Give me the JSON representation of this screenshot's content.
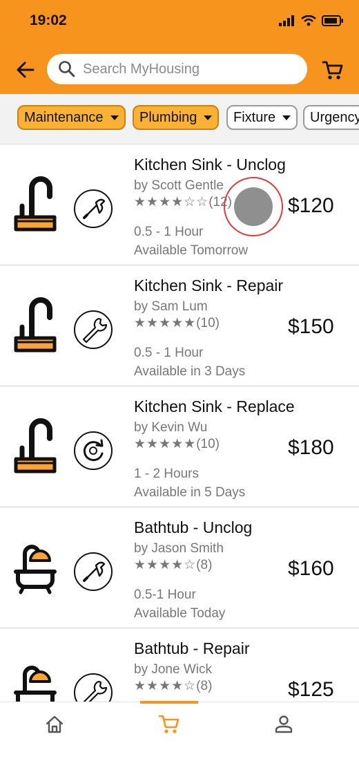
{
  "status_bar": {
    "time": "19:02"
  },
  "search": {
    "placeholder": "Search MyHousing"
  },
  "filters": [
    {
      "label": "Maintenance",
      "active": true
    },
    {
      "label": "Plumbing",
      "active": true
    },
    {
      "label": "Fixture",
      "active": false
    },
    {
      "label": "Urgency",
      "active": false
    }
  ],
  "items": [
    {
      "title": "Kitchen Sink - Unclog",
      "provider": "by Scott Gentle",
      "stars": "★★★★☆☆",
      "reviews": "(12)",
      "duration": "0.5 - 1 Hour",
      "availability": "Available Tomorrow",
      "price": "$120",
      "fixture_icon": "sink-icon",
      "action_icon": "plunger-icon"
    },
    {
      "title": "Kitchen Sink - Repair",
      "provider": "by Sam Lum",
      "stars": "★★★★★",
      "reviews": "(10)",
      "duration": "0.5 - 1 Hour",
      "availability": "Available in 3 Days",
      "price": "$150",
      "fixture_icon": "sink-icon",
      "action_icon": "wrench-icon"
    },
    {
      "title": "Kitchen Sink - Replace",
      "provider": "by Kevin Wu",
      "stars": "★★★★★",
      "reviews": "(10)",
      "duration": "1 - 2 Hours",
      "availability": "Available in 5 Days",
      "price": "$180",
      "fixture_icon": "sink-icon",
      "action_icon": "replace-icon"
    },
    {
      "title": "Bathtub - Unclog",
      "provider": "by Jason Smith",
      "stars": "★★★★☆",
      "reviews": "(8)",
      "duration": "0.5-1 Hour",
      "availability": "Available Today",
      "price": "$160",
      "fixture_icon": "bathtub-icon",
      "action_icon": "plunger-icon"
    },
    {
      "title": "Bathtub - Repair",
      "provider": "by Jone Wick",
      "stars": "★★★★☆",
      "reviews": "(8)",
      "duration": "",
      "availability": "",
      "price": "$125",
      "fixture_icon": "bathtub-icon",
      "action_icon": "wrench-icon"
    }
  ],
  "bottom_nav": [
    {
      "name": "home",
      "icon": "home-icon",
      "active": false
    },
    {
      "name": "cart",
      "icon": "cart-icon",
      "active": true
    },
    {
      "name": "profile",
      "icon": "profile-icon",
      "active": false
    }
  ],
  "colors": {
    "accent": "#F7941E",
    "chip_active": "#F9B233",
    "chip_active_border": "#C88214",
    "tap_ring": "#E53935"
  }
}
